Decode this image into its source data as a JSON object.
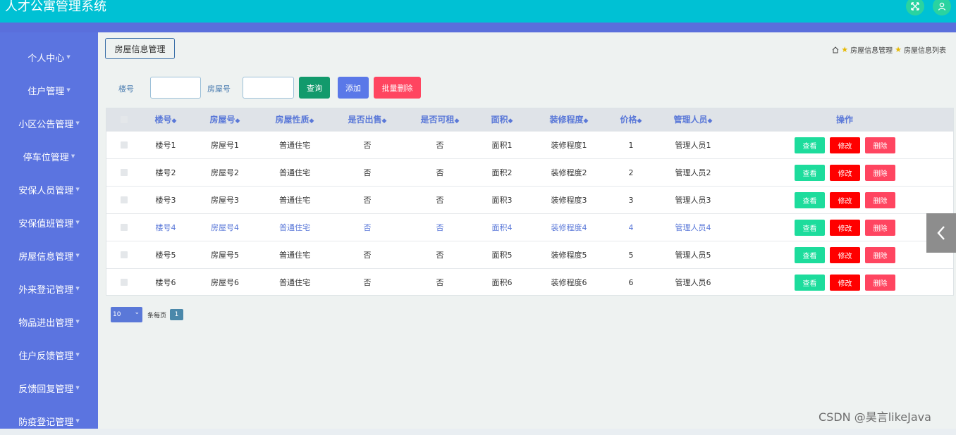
{
  "app": {
    "title": "人才公寓管理系统"
  },
  "colors": {
    "accent": "#00c1d4",
    "sidebar": "#5b74e0",
    "view": "#1ddc9c",
    "edit": "#ff0000",
    "delete": "#ff4560"
  },
  "sidebar": {
    "items": [
      {
        "label": "个人中心"
      },
      {
        "label": "住户管理"
      },
      {
        "label": "小区公告管理"
      },
      {
        "label": "停车位管理"
      },
      {
        "label": "安保人员管理"
      },
      {
        "label": "安保值班管理"
      },
      {
        "label": "房屋信息管理"
      },
      {
        "label": "外来登记管理"
      },
      {
        "label": "物品进出管理"
      },
      {
        "label": "住户反馈管理"
      },
      {
        "label": "反馈回复管理"
      },
      {
        "label": "防疫登记管理"
      }
    ]
  },
  "page": {
    "tab_label": "房屋信息管理"
  },
  "breadcrumb": {
    "items": [
      "房屋信息管理",
      "房屋信息列表"
    ]
  },
  "search": {
    "building_label": "楼号",
    "room_label": "房屋号",
    "query_button": "查询",
    "add_button": "添加",
    "batch_delete_button": "批量删除"
  },
  "table": {
    "columns": [
      "楼号",
      "房屋号",
      "房屋性质",
      "是否出售",
      "是否可租",
      "面积",
      "装修程度",
      "价格",
      "管理人员",
      "操作"
    ],
    "rows": [
      [
        "楼号1",
        "房屋号1",
        "普通住宅",
        "否",
        "否",
        "面积1",
        "装修程度1",
        "1",
        "管理人员1"
      ],
      [
        "楼号2",
        "房屋号2",
        "普通住宅",
        "否",
        "否",
        "面积2",
        "装修程度2",
        "2",
        "管理人员2"
      ],
      [
        "楼号3",
        "房屋号3",
        "普通住宅",
        "否",
        "否",
        "面积3",
        "装修程度3",
        "3",
        "管理人员3"
      ],
      [
        "楼号4",
        "房屋号4",
        "普通住宅",
        "否",
        "否",
        "面积4",
        "装修程度4",
        "4",
        "管理人员4"
      ],
      [
        "楼号5",
        "房屋号5",
        "普通住宅",
        "否",
        "否",
        "面积5",
        "装修程度5",
        "5",
        "管理人员5"
      ],
      [
        "楼号6",
        "房屋号6",
        "普通住宅",
        "否",
        "否",
        "面积6",
        "装修程度6",
        "6",
        "管理人员6"
      ]
    ],
    "actions": {
      "view": "查看",
      "edit": "修改",
      "delete": "删除"
    }
  },
  "pagination": {
    "page_size": "10",
    "per_page_label": "条每页",
    "current_page": "1"
  },
  "watermark": "CSDN @昊言likeJava"
}
